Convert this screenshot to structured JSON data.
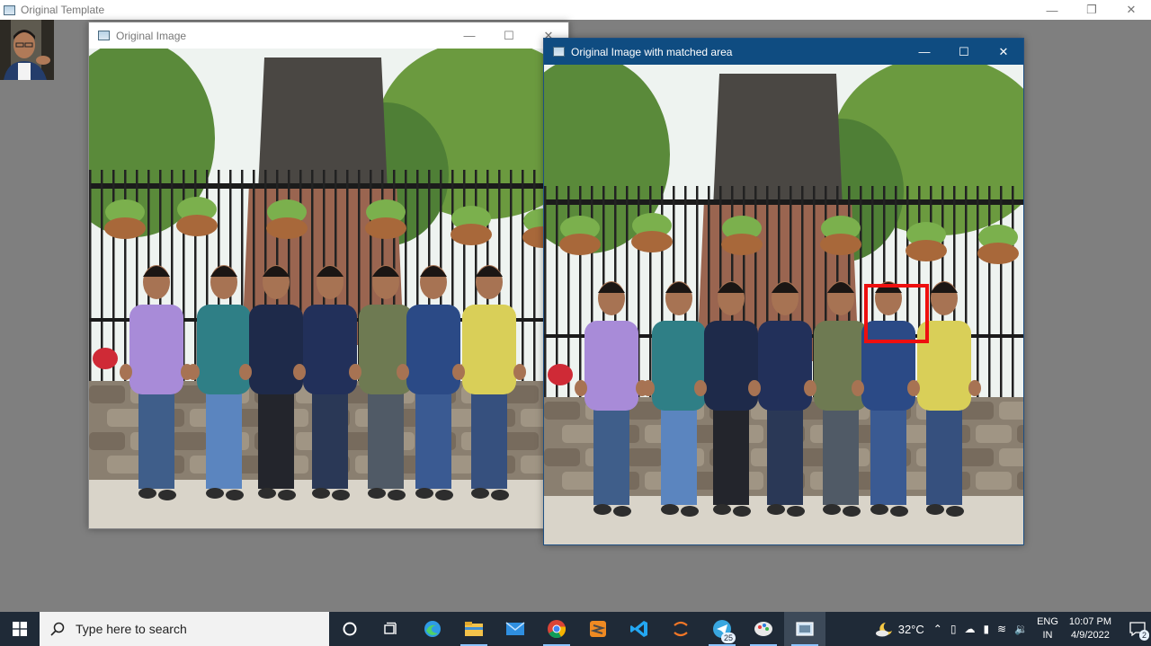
{
  "template_window": {
    "title": "Original Template",
    "controls": {
      "minimize": "—",
      "restore": "❐",
      "close": "✕"
    }
  },
  "window_original": {
    "title": "Original Image",
    "controls": {
      "minimize": "—",
      "maximize": "☐",
      "close": "✕"
    }
  },
  "window_matched": {
    "title": "Original Image with matched area",
    "controls": {
      "minimize": "—",
      "maximize": "☐",
      "close": "✕"
    }
  },
  "colors": {
    "desktop": "#7f7f7f",
    "active_titlebar": "#0f4c81",
    "match_box": "#ee0f0f",
    "taskbar": "#1f2a37"
  },
  "taskbar": {
    "search_placeholder": "Type here to search",
    "apps": [
      {
        "name": "cortana-icon"
      },
      {
        "name": "task-view-icon"
      },
      {
        "name": "edge-icon"
      },
      {
        "name": "file-explorer-icon"
      },
      {
        "name": "mail-icon"
      },
      {
        "name": "chrome-icon"
      },
      {
        "name": "sublime-text-icon"
      },
      {
        "name": "vscode-icon"
      },
      {
        "name": "jupyter-icon"
      },
      {
        "name": "telegram-icon",
        "badge": "25"
      },
      {
        "name": "paint-icon"
      },
      {
        "name": "python-window-icon"
      }
    ],
    "weather": {
      "temp": "32°C"
    },
    "lang": {
      "line1": "ENG",
      "line2": "IN"
    },
    "clock": {
      "time": "10:07 PM",
      "date": "4/9/2022"
    },
    "notification_count": "2"
  }
}
